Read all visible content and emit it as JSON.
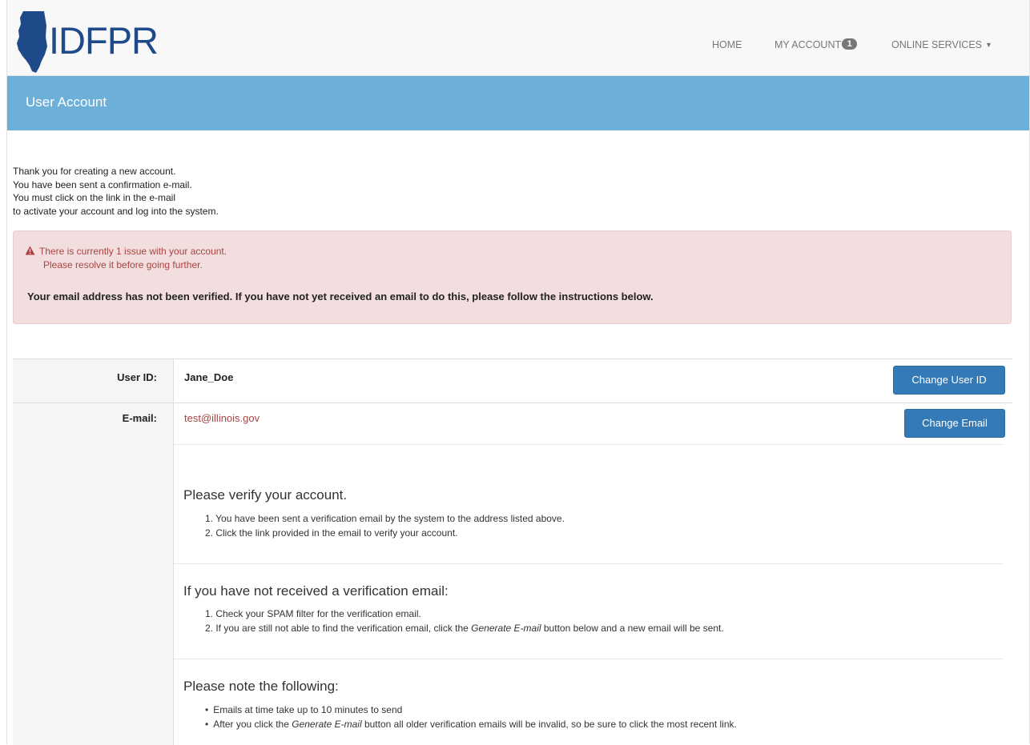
{
  "nav": {
    "brand": "IDFPR",
    "home": "HOME",
    "my_account": "MY ACCOUNT",
    "my_account_badge": "1",
    "online_services": "ONLINE SERVICES"
  },
  "header": {
    "title": "User Account"
  },
  "intro": {
    "lines": [
      "Thank you for creating a new account.",
      "You have been sent a confirmation e-mail.",
      "You must click on the link in the e-mail",
      "to activate your account and log into the system."
    ]
  },
  "alert": {
    "line1": "There is currently 1 issue with your account.",
    "line2": "Please resolve it before going further.",
    "strong": "Your email address has not been verified. If you have not yet received an email to do this, please follow the instructions below."
  },
  "account": {
    "user_id_label": "User ID:",
    "user_id_value": "Jane_Doe",
    "change_user_id": "Change User ID",
    "email_label": "E-mail:",
    "email_value": "test@illinois.gov",
    "change_email": "Change Email"
  },
  "verify": {
    "heading": "Please verify your account.",
    "items": [
      "1. You have been sent a verification email by the system to the address listed above.",
      "2. Click the link provided in the email to verify your account."
    ]
  },
  "not_received": {
    "heading": "If you have not received a verification email:",
    "item1": "1. Check your SPAM filter for the verification email.",
    "item2_prefix": "2. If you are still not able to find the verification email, click the ",
    "item2_em": "Generate E-mail",
    "item2_suffix": " button below and a new email will be sent."
  },
  "note": {
    "heading": "Please note the following:",
    "item1": "Emails at time take up to 10 minutes to send",
    "item2_prefix": "After you click the ",
    "item2_em": "Generate E-mail",
    "item2_suffix": " button all older verification emails will be invalid, so be sure to click the most recent link."
  },
  "colors": {
    "brand_blue": "#1f4a8a",
    "header_band": "#6cb0d9",
    "alert_bg": "#f2dede",
    "alert_text": "#a94442",
    "button": "#337ab7"
  }
}
